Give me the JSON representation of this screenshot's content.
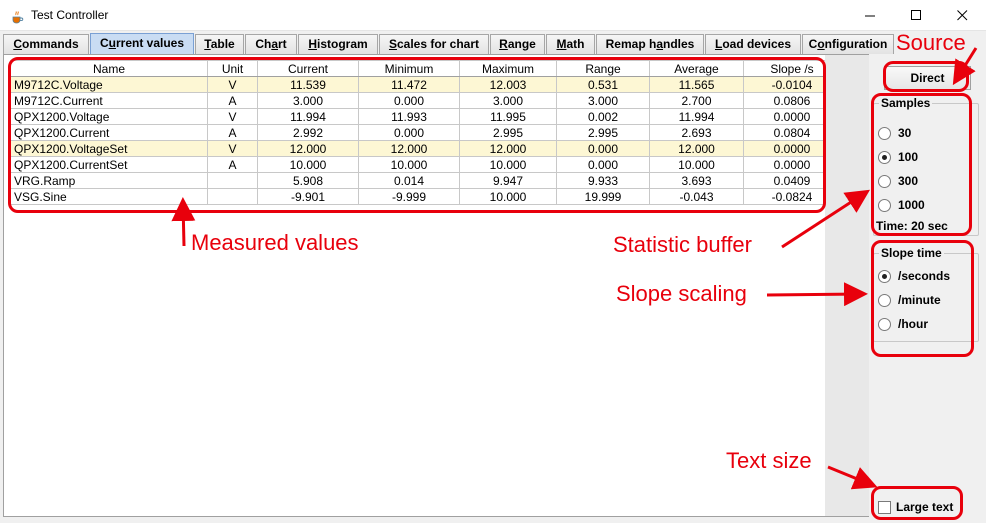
{
  "window": {
    "title": "Test Controller",
    "icon": "java-cup-icon"
  },
  "tabs": [
    {
      "pre": "",
      "u": "C",
      "post": "ommands"
    },
    {
      "pre": "C",
      "u": "u",
      "post": "rrent values",
      "active": true
    },
    {
      "pre": "",
      "u": "T",
      "post": "able"
    },
    {
      "pre": "Ch",
      "u": "a",
      "post": "rt"
    },
    {
      "pre": "",
      "u": "H",
      "post": "istogram"
    },
    {
      "pre": "",
      "u": "S",
      "post": "cales for chart"
    },
    {
      "pre": "",
      "u": "R",
      "post": "ange"
    },
    {
      "pre": "",
      "u": "M",
      "post": "ath"
    },
    {
      "pre": "Remap h",
      "u": "a",
      "post": "ndles"
    },
    {
      "pre": "",
      "u": "L",
      "post": "oad devices"
    },
    {
      "pre": "C",
      "u": "o",
      "post": "nfiguration"
    }
  ],
  "table": {
    "columns": [
      "Name",
      "Unit",
      "Current",
      "Minimum",
      "Maximum",
      "Range",
      "Average",
      "Slope /s"
    ],
    "rows": [
      {
        "cells": [
          "M9712C.Voltage",
          "V",
          "11.539",
          "11.472",
          "12.003",
          "0.531",
          "11.565",
          "-0.0104"
        ],
        "highlight": true
      },
      {
        "cells": [
          "M9712C.Current",
          "A",
          "3.000",
          "0.000",
          "3.000",
          "3.000",
          "2.700",
          "0.0806"
        ],
        "highlight": false
      },
      {
        "cells": [
          "QPX1200.Voltage",
          "V",
          "11.994",
          "11.993",
          "11.995",
          "0.002",
          "11.994",
          "0.0000"
        ],
        "highlight": false
      },
      {
        "cells": [
          "QPX1200.Current",
          "A",
          "2.992",
          "0.000",
          "2.995",
          "2.995",
          "2.693",
          "0.0804"
        ],
        "highlight": false
      },
      {
        "cells": [
          "QPX1200.VoltageSet",
          "V",
          "12.000",
          "12.000",
          "12.000",
          "0.000",
          "12.000",
          "0.0000"
        ],
        "highlight": true
      },
      {
        "cells": [
          "QPX1200.CurrentSet",
          "A",
          "10.000",
          "10.000",
          "10.000",
          "0.000",
          "10.000",
          "0.0000"
        ],
        "highlight": false
      },
      {
        "cells": [
          "VRG.Ramp",
          "",
          "5.908",
          "0.014",
          "9.947",
          "9.933",
          "3.693",
          "0.0409"
        ],
        "highlight": false
      },
      {
        "cells": [
          "VSG.Sine",
          "",
          "-9.901",
          "-9.999",
          "10.000",
          "19.999",
          "-0.043",
          "-0.0824"
        ],
        "highlight": false
      }
    ]
  },
  "side": {
    "source_button": "Direct",
    "samples": {
      "title": "Samples",
      "options": [
        "30",
        "100",
        "300",
        "1000"
      ],
      "selected": 1,
      "time_text": "Time: 20 sec"
    },
    "slope": {
      "title": "Slope time",
      "options": [
        "/seconds",
        "/minute",
        "/hour"
      ],
      "selected": 0
    },
    "large_text": {
      "label": "Large text",
      "checked": false
    }
  },
  "annotations": {
    "color": "#e8000c",
    "source": "Source",
    "measured_values": "Measured values",
    "statistic_buffer": "Statistic buffer",
    "slope_scaling": "Slope scaling",
    "text_size": "Text size"
  },
  "colors": {
    "highlight_row": "#fdf7d4",
    "active_tab": "#c9dcf3"
  }
}
